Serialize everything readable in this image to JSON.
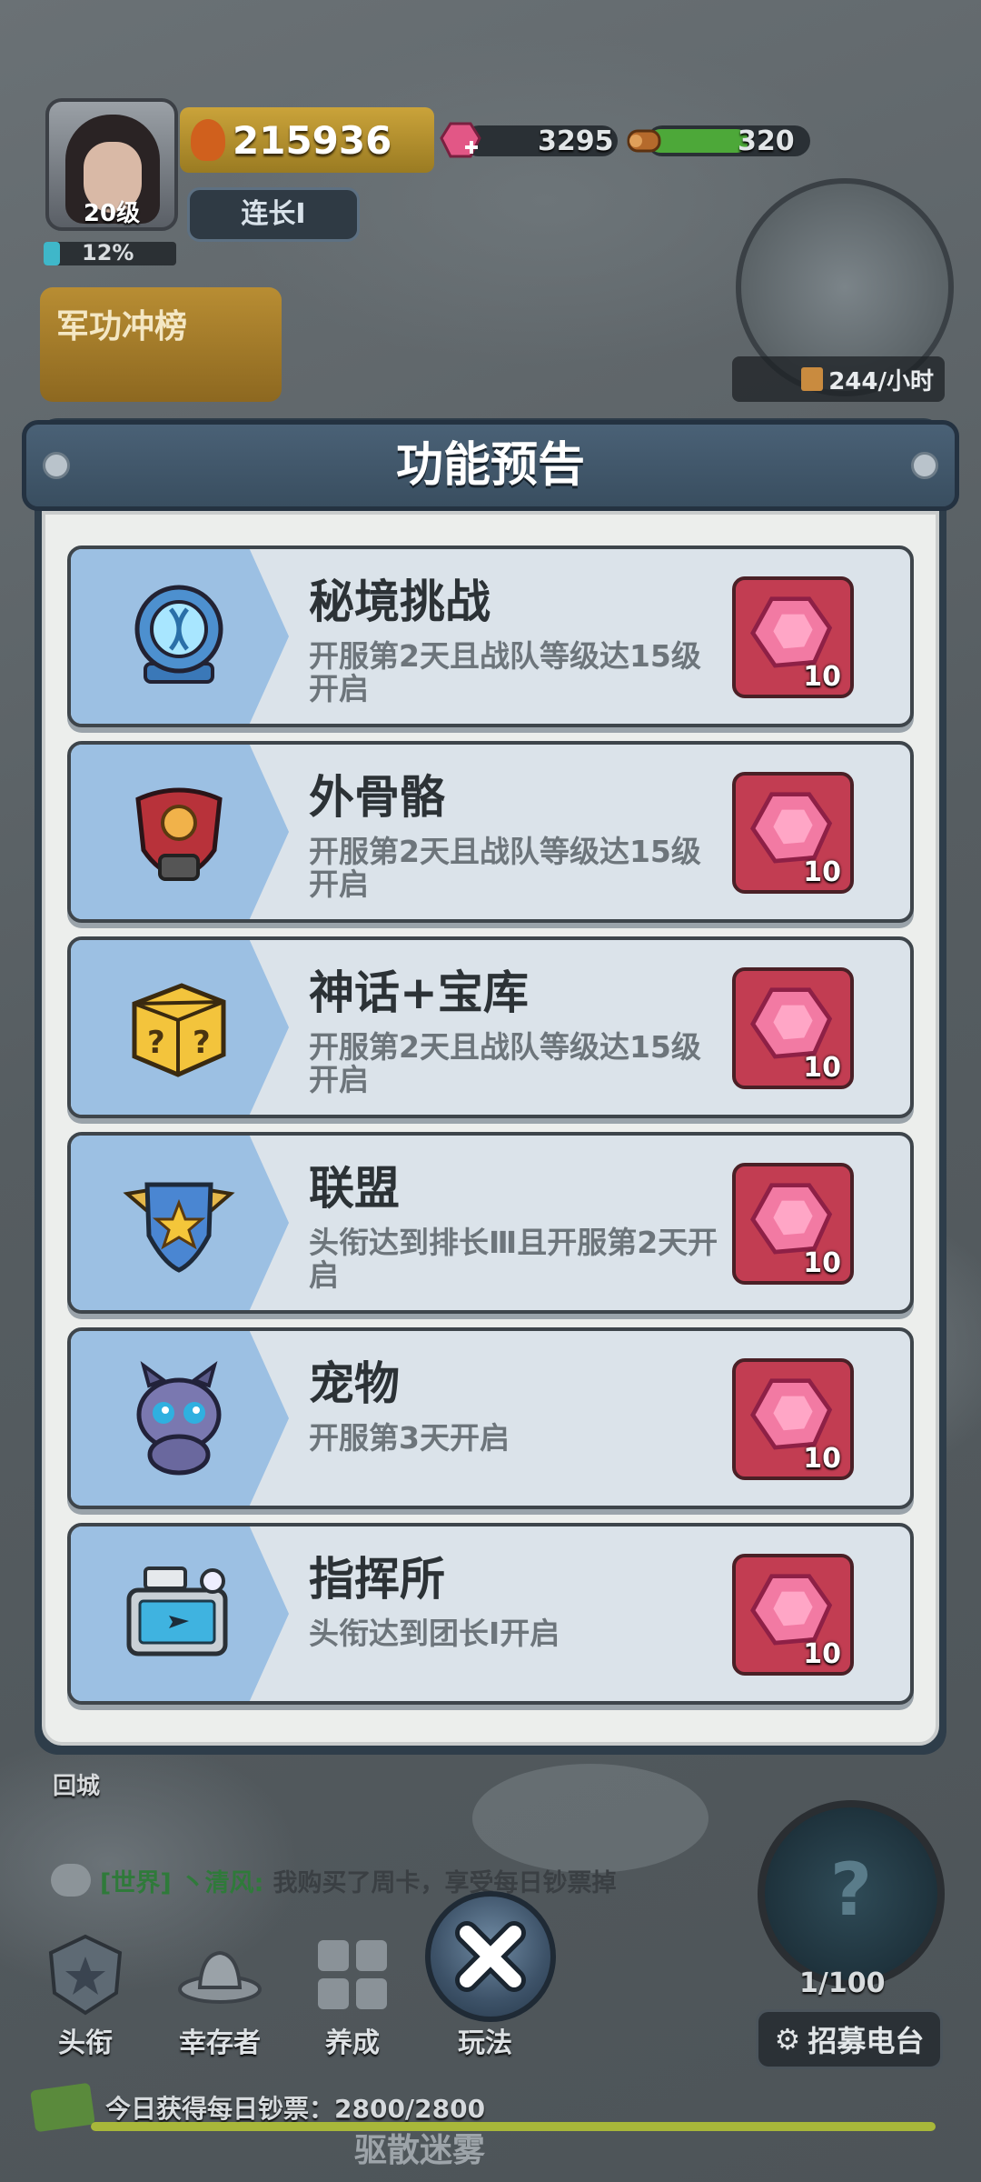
{
  "hud": {
    "level": "20级",
    "exp_percent": "12%",
    "exp_fraction": 0.12,
    "power": "215936",
    "gems": "3295",
    "wood": "320",
    "rank": "连长Ⅰ",
    "event_label": "军功冲榜",
    "production_rate": "244/小时"
  },
  "dialog": {
    "title": "功能预告",
    "items": [
      {
        "title": "秘境挑战",
        "desc": "开服第2天且战队等级达15级开启",
        "reward": "10",
        "icon": "portal-device-icon"
      },
      {
        "title": "外骨骼",
        "desc": "开服第2天且战队等级达15级开启",
        "reward": "10",
        "icon": "armor-chest-icon"
      },
      {
        "title": "神话+宝库",
        "desc": "开服第2天且战队等级达15级开启",
        "reward": "10",
        "icon": "mystery-box-icon"
      },
      {
        "title": "联盟",
        "desc": "头衔达到排长Ⅲ且开服第2天开启",
        "reward": "10",
        "icon": "shield-star-icon"
      },
      {
        "title": "宠物",
        "desc": "开服第3天开启",
        "reward": "10",
        "icon": "pet-creature-icon"
      },
      {
        "title": "指挥所",
        "desc": "头衔达到团长Ⅰ开启",
        "reward": "10",
        "icon": "command-post-icon"
      }
    ]
  },
  "bottom": {
    "return_city": "回城",
    "chat": {
      "channel": "[世界]",
      "name": "丶清风:",
      "message": "我购买了周卡，享受每日钞票掉"
    },
    "nav": [
      {
        "label": "头衔",
        "icon": "badge-star-icon"
      },
      {
        "label": "幸存者",
        "icon": "cowboy-hat-icon"
      },
      {
        "label": "养成",
        "icon": "grid-squares-icon"
      },
      {
        "label": "玩法",
        "icon": "play-mode-icon"
      }
    ],
    "radar_count": "1/100",
    "recruit_label": "招募电台",
    "daily_text": "今日获得每日钞票：2800/2800",
    "daily_fraction": 1.0,
    "hint_text": "驱散迷雾"
  },
  "colors": {
    "card_bg": "#dbe3ea",
    "icon_zone": "#9cc0e3",
    "reward_bg": "#c23d52",
    "header_bg": "#4a6176"
  }
}
